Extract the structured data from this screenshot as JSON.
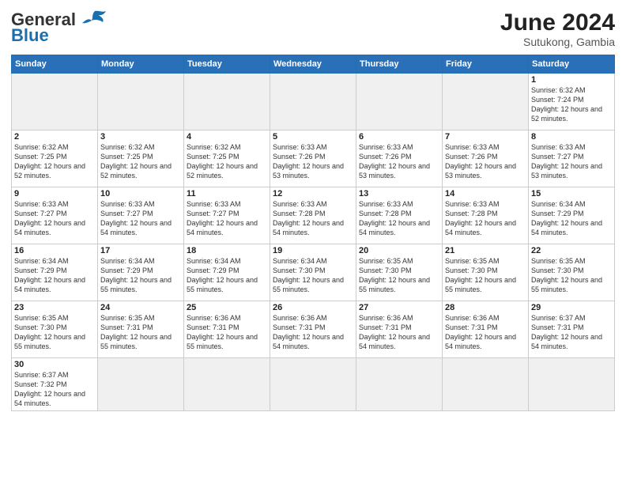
{
  "header": {
    "logo_general": "General",
    "logo_blue": "Blue",
    "month_year": "June 2024",
    "location": "Sutukong, Gambia"
  },
  "weekdays": [
    "Sunday",
    "Monday",
    "Tuesday",
    "Wednesday",
    "Thursday",
    "Friday",
    "Saturday"
  ],
  "weeks": [
    [
      {
        "day": "",
        "info": "",
        "empty": true
      },
      {
        "day": "",
        "info": "",
        "empty": true
      },
      {
        "day": "",
        "info": "",
        "empty": true
      },
      {
        "day": "",
        "info": "",
        "empty": true
      },
      {
        "day": "",
        "info": "",
        "empty": true
      },
      {
        "day": "",
        "info": "",
        "empty": true
      },
      {
        "day": "1",
        "info": "Sunrise: 6:32 AM\nSunset: 7:24 PM\nDaylight: 12 hours and 52 minutes."
      }
    ],
    [
      {
        "day": "2",
        "info": "Sunrise: 6:32 AM\nSunset: 7:25 PM\nDaylight: 12 hours and 52 minutes."
      },
      {
        "day": "3",
        "info": "Sunrise: 6:32 AM\nSunset: 7:25 PM\nDaylight: 12 hours and 52 minutes."
      },
      {
        "day": "4",
        "info": "Sunrise: 6:32 AM\nSunset: 7:25 PM\nDaylight: 12 hours and 52 minutes."
      },
      {
        "day": "5",
        "info": "Sunrise: 6:33 AM\nSunset: 7:26 PM\nDaylight: 12 hours and 53 minutes."
      },
      {
        "day": "6",
        "info": "Sunrise: 6:33 AM\nSunset: 7:26 PM\nDaylight: 12 hours and 53 minutes."
      },
      {
        "day": "7",
        "info": "Sunrise: 6:33 AM\nSunset: 7:26 PM\nDaylight: 12 hours and 53 minutes."
      },
      {
        "day": "8",
        "info": "Sunrise: 6:33 AM\nSunset: 7:27 PM\nDaylight: 12 hours and 53 minutes."
      }
    ],
    [
      {
        "day": "9",
        "info": "Sunrise: 6:33 AM\nSunset: 7:27 PM\nDaylight: 12 hours and 54 minutes."
      },
      {
        "day": "10",
        "info": "Sunrise: 6:33 AM\nSunset: 7:27 PM\nDaylight: 12 hours and 54 minutes."
      },
      {
        "day": "11",
        "info": "Sunrise: 6:33 AM\nSunset: 7:27 PM\nDaylight: 12 hours and 54 minutes."
      },
      {
        "day": "12",
        "info": "Sunrise: 6:33 AM\nSunset: 7:28 PM\nDaylight: 12 hours and 54 minutes."
      },
      {
        "day": "13",
        "info": "Sunrise: 6:33 AM\nSunset: 7:28 PM\nDaylight: 12 hours and 54 minutes."
      },
      {
        "day": "14",
        "info": "Sunrise: 6:33 AM\nSunset: 7:28 PM\nDaylight: 12 hours and 54 minutes."
      },
      {
        "day": "15",
        "info": "Sunrise: 6:34 AM\nSunset: 7:29 PM\nDaylight: 12 hours and 54 minutes."
      }
    ],
    [
      {
        "day": "16",
        "info": "Sunrise: 6:34 AM\nSunset: 7:29 PM\nDaylight: 12 hours and 54 minutes."
      },
      {
        "day": "17",
        "info": "Sunrise: 6:34 AM\nSunset: 7:29 PM\nDaylight: 12 hours and 55 minutes."
      },
      {
        "day": "18",
        "info": "Sunrise: 6:34 AM\nSunset: 7:29 PM\nDaylight: 12 hours and 55 minutes."
      },
      {
        "day": "19",
        "info": "Sunrise: 6:34 AM\nSunset: 7:30 PM\nDaylight: 12 hours and 55 minutes."
      },
      {
        "day": "20",
        "info": "Sunrise: 6:35 AM\nSunset: 7:30 PM\nDaylight: 12 hours and 55 minutes."
      },
      {
        "day": "21",
        "info": "Sunrise: 6:35 AM\nSunset: 7:30 PM\nDaylight: 12 hours and 55 minutes."
      },
      {
        "day": "22",
        "info": "Sunrise: 6:35 AM\nSunset: 7:30 PM\nDaylight: 12 hours and 55 minutes."
      }
    ],
    [
      {
        "day": "23",
        "info": "Sunrise: 6:35 AM\nSunset: 7:30 PM\nDaylight: 12 hours and 55 minutes."
      },
      {
        "day": "24",
        "info": "Sunrise: 6:35 AM\nSunset: 7:31 PM\nDaylight: 12 hours and 55 minutes."
      },
      {
        "day": "25",
        "info": "Sunrise: 6:36 AM\nSunset: 7:31 PM\nDaylight: 12 hours and 55 minutes."
      },
      {
        "day": "26",
        "info": "Sunrise: 6:36 AM\nSunset: 7:31 PM\nDaylight: 12 hours and 54 minutes."
      },
      {
        "day": "27",
        "info": "Sunrise: 6:36 AM\nSunset: 7:31 PM\nDaylight: 12 hours and 54 minutes."
      },
      {
        "day": "28",
        "info": "Sunrise: 6:36 AM\nSunset: 7:31 PM\nDaylight: 12 hours and 54 minutes."
      },
      {
        "day": "29",
        "info": "Sunrise: 6:37 AM\nSunset: 7:31 PM\nDaylight: 12 hours and 54 minutes."
      }
    ],
    [
      {
        "day": "30",
        "info": "Sunrise: 6:37 AM\nSunset: 7:32 PM\nDaylight: 12 hours and 54 minutes."
      },
      {
        "day": "",
        "info": "",
        "empty": true
      },
      {
        "day": "",
        "info": "",
        "empty": true
      },
      {
        "day": "",
        "info": "",
        "empty": true
      },
      {
        "day": "",
        "info": "",
        "empty": true
      },
      {
        "day": "",
        "info": "",
        "empty": true
      },
      {
        "day": "",
        "info": "",
        "empty": true
      }
    ]
  ]
}
